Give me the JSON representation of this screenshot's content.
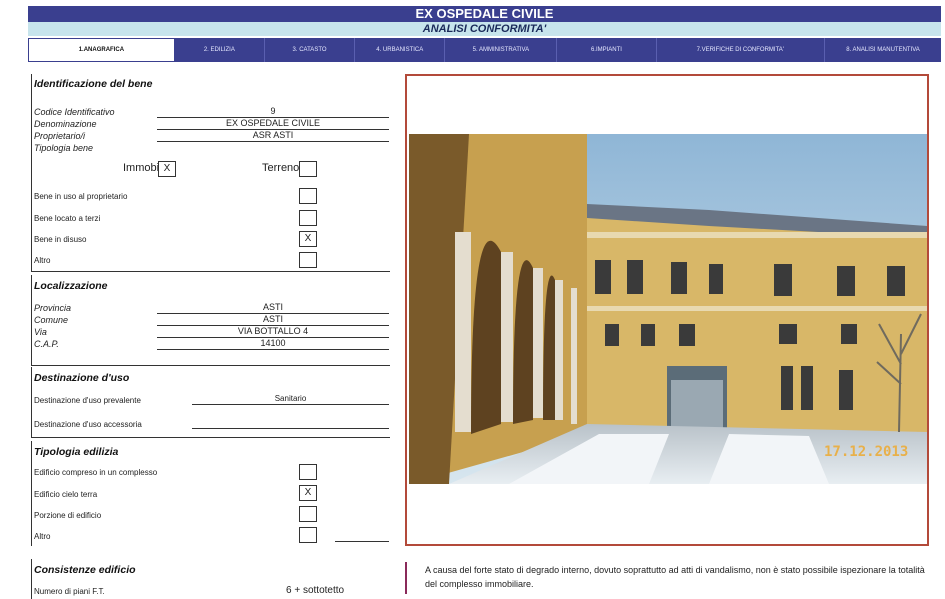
{
  "header": {
    "title": "EX OSPEDALE CIVILE",
    "subtitle": "ANALISI CONFORMITA'"
  },
  "tabs": [
    {
      "label": "1.ANAGRAFICA",
      "active": true
    },
    {
      "label": "2. EDILIZIA",
      "active": false
    },
    {
      "label": "3. CATASTO",
      "active": false
    },
    {
      "label": "4. URBANISTICA",
      "active": false
    },
    {
      "label": "5. AMMINISTRATIVA",
      "active": false
    },
    {
      "label": "6.IMPIANTI",
      "active": false
    },
    {
      "label": "7.VERIFICHE DI CONFORMITA'",
      "active": false
    },
    {
      "label": "8. ANALISI MANUTENTIVA",
      "active": false
    }
  ],
  "identificazione": {
    "title": "Identificazione del bene",
    "codice_label": "Codice Identificativo",
    "codice_value": "9",
    "denominazione_label": "Denominazione",
    "denominazione_value": "EX OSPEDALE CIVILE",
    "proprietario_label": "Proprietario/i",
    "proprietario_value": "ASR ASTI",
    "tipologia_label": "Tipologia bene",
    "immobile_label": "Immobile",
    "immobile_value": "X",
    "terreno_label": "Terreno",
    "terreno_value": "",
    "uso_proprietario_label": "Bene  in uso al proprietario",
    "uso_proprietario_value": "",
    "locato_label": "Bene locato a terzi",
    "locato_value": "",
    "disuso_label": "Bene in disuso",
    "disuso_value": "X",
    "altro_label": "Altro",
    "altro_value": ""
  },
  "localizzazione": {
    "title": "Localizzazione",
    "provincia_label": "Provincia",
    "provincia_value": "ASTI",
    "comune_label": "Comune",
    "comune_value": "ASTI",
    "via_label": "Via",
    "via_value": "VIA BOTTALLO 4",
    "cap_label": "C.A.P.",
    "cap_value": "14100"
  },
  "destinazione": {
    "title": "Destinazione d'uso",
    "prevalente_label": "Destinazione d'uso prevalente",
    "prevalente_value": "Sanitario",
    "accessoria_label": "Destinazione d'uso accessoria",
    "accessoria_value": ""
  },
  "tipologia_edilizia": {
    "title": "Tipologia edilizia",
    "complesso_label": "Edificio compreso in un complesso",
    "complesso_value": "",
    "cielo_terra_label": "Edificio cielo terra",
    "cielo_terra_value": "X",
    "porzione_label": "Porzione di edificio",
    "porzione_value": "",
    "altro_label": "Altro",
    "altro_value": ""
  },
  "consistenze": {
    "title": "Consistenze edificio",
    "piani_label": "Numero di piani F.T.",
    "piani_value": "6 + sottotetto"
  },
  "photo": {
    "date_stamp": "17.12.2013"
  },
  "note": {
    "text": "A causa del forte stato di degrado interno, dovuto soprattutto ad atti di vandalismo, non è stato possibile ispezionare la totalità del complesso immobiliare."
  },
  "colors": {
    "header_bg": "#3a3f8f",
    "subheader_bg": "#c7e4ec",
    "photo_border": "#b34a3a"
  }
}
